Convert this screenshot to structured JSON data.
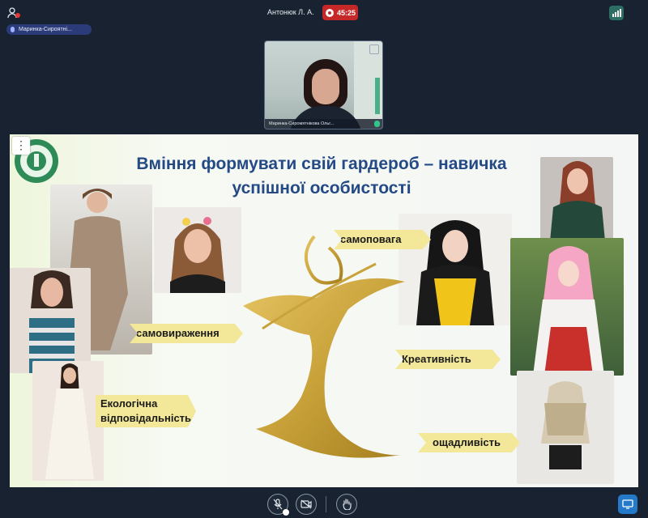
{
  "topbar": {
    "host_name": "Антонюк Л. А.",
    "recording_time": "45:25"
  },
  "speaker_chip": "Маринка-Сироятні...",
  "video": {
    "participant_name": "Маринка-Сиромятнікова Ольг..."
  },
  "slide": {
    "title_line1": "Вміння формувати свій гардероб – навичка",
    "title_line2": "успішної особистості",
    "labels": {
      "self_respect": "самоповага",
      "self_expression": "самовираження",
      "creativity": "Креативність",
      "eco_line1": "Екологічна",
      "eco_line2": "відповідальність",
      "thrift": "ощадливість"
    }
  },
  "colors": {
    "background": "#182230",
    "record": "#c62828",
    "title": "#244a86",
    "label_fill": "#f3e89a",
    "gold": "#c9a23a",
    "screen_share": "#2479c9"
  },
  "icons": {
    "participants": "participants-icon",
    "record": "record-icon",
    "signal": "signal-icon",
    "microphone": "microphone-icon",
    "camera": "camera-icon",
    "raise_hand": "hand-icon",
    "screen_share": "screen-share-icon",
    "expand": "expand-icon",
    "menu": "more-vertical-icon"
  }
}
